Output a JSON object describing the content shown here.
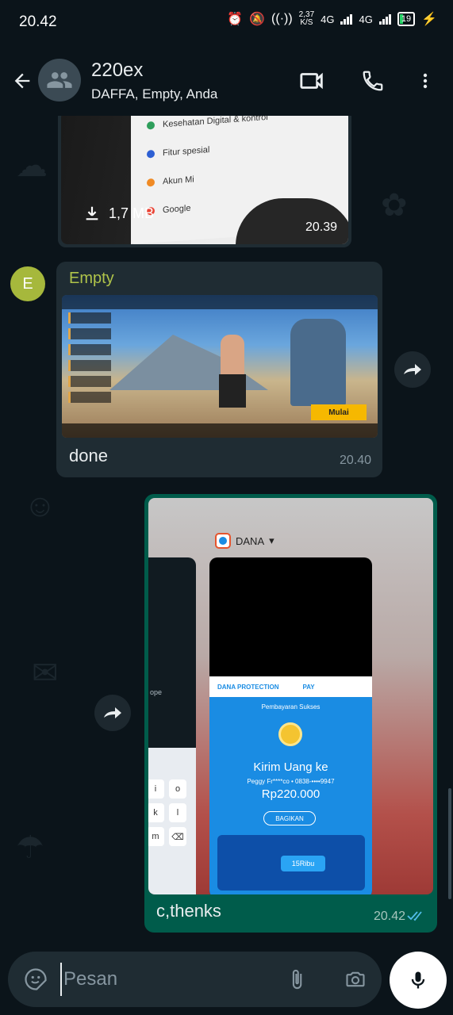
{
  "status_bar": {
    "time": "20.42",
    "net_speed_value": "2,37",
    "net_speed_unit": "K/S",
    "net1": "4G",
    "net2": "4G",
    "battery": "19"
  },
  "header": {
    "title": "220ex",
    "subtitle": "DAFFA, Empty, Anda"
  },
  "messages": [
    {
      "type": "image",
      "direction": "outgoing",
      "file_size": "1,7 MB",
      "time": "20.39",
      "screenshot_text": [
        "Kesehatan Digital & kontrol",
        "Fitur spesial",
        "Akun Mi",
        "Google"
      ]
    },
    {
      "type": "image",
      "direction": "incoming",
      "sender": "Empty",
      "sender_initial": "E",
      "game_button": "Mulai",
      "caption": "done",
      "time": "20.40"
    },
    {
      "type": "image",
      "direction": "outgoing",
      "app_label": "DANA",
      "dana": {
        "brand_left": "DANA PROTECTION",
        "brand_right": "PAY",
        "status": "Pembayaran Sukses",
        "title": "Kirim Uang ke",
        "recipient": "Peggy Fr****co • 0838-••••9947",
        "amount": "Rp220.000",
        "share": "BAGIKAN",
        "promo": "15Ribu"
      },
      "left_card_text": "ope",
      "keyboard_keys": [
        "i",
        "o",
        "k",
        "l",
        "m",
        "⌫"
      ],
      "caption": "c,thenks",
      "time": "20.42",
      "status": "read"
    }
  ],
  "input": {
    "placeholder": "Pesan"
  },
  "colors": {
    "background": "#0b141a",
    "incoming_bubble": "#1f2c33",
    "outgoing_bubble": "#005c4b",
    "sender_name": "#b0c44a",
    "read_ticks": "#53bdeb"
  }
}
